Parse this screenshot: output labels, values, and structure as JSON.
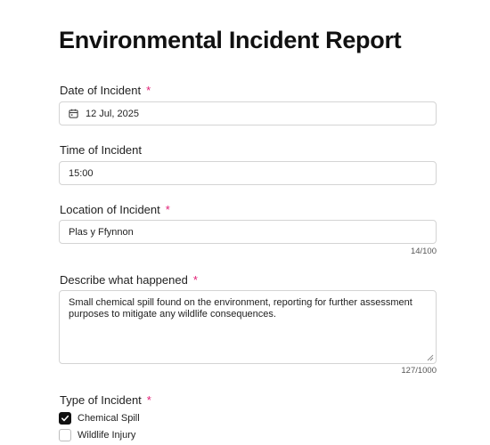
{
  "form": {
    "title": "Environmental Incident Report",
    "required_marker": "*",
    "date": {
      "label": "Date of Incident",
      "value": "12 Jul, 2025",
      "icon": "calendar-icon"
    },
    "time": {
      "label": "Time of Incident",
      "value": "15:00"
    },
    "location": {
      "label": "Location of Incident",
      "value": "Plas y Ffynnon",
      "counter": "14/100"
    },
    "description": {
      "label": "Describe what happened",
      "value": "Small chemical spill found on the environment, reporting for further assessment purposes to mitigate any wildlife consequences.",
      "counter": "127/1000"
    },
    "incident_type": {
      "label": "Type of Incident",
      "options": [
        {
          "label": "Chemical Spill",
          "checked": true
        },
        {
          "label": "Wildlife Injury",
          "checked": false
        }
      ]
    }
  },
  "colors": {
    "required": "#e11d74",
    "checkbox_checked": "#111111",
    "border": "#d4d4d4"
  }
}
